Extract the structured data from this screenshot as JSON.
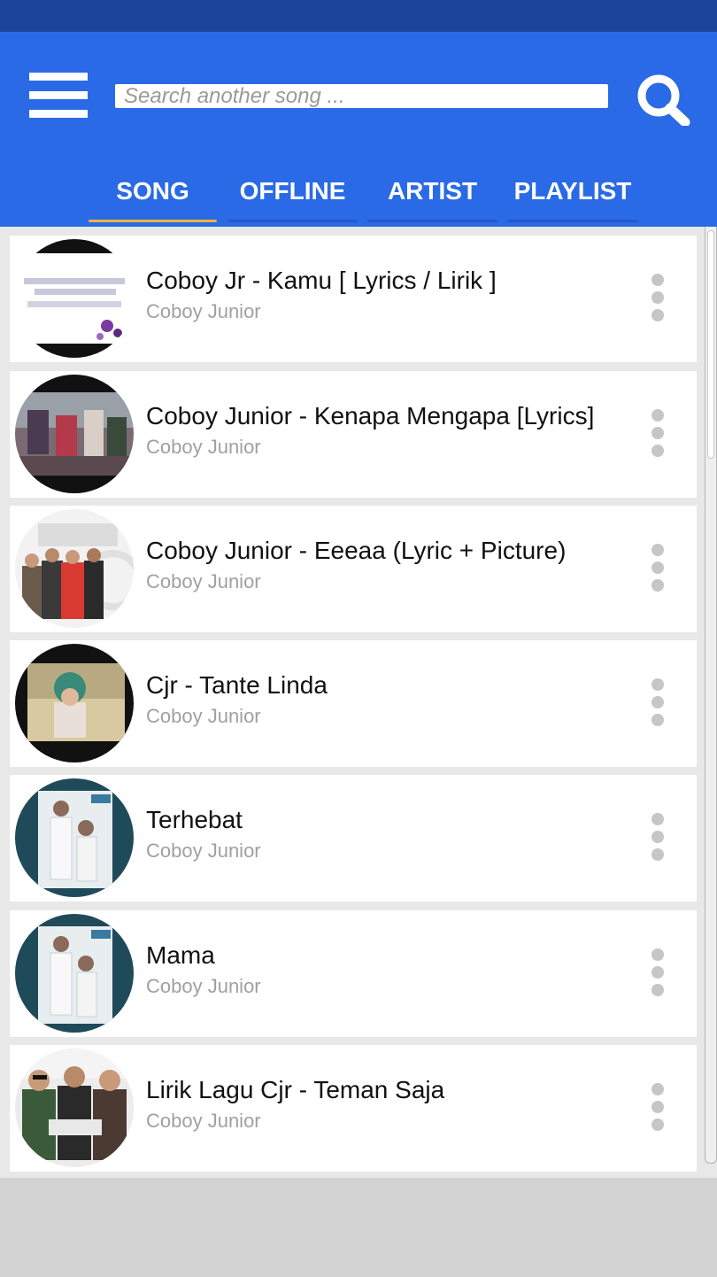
{
  "header": {
    "search_placeholder": "Search another song ...",
    "tabs": [
      {
        "label": "SONG",
        "active": true
      },
      {
        "label": "OFFLINE",
        "active": false
      },
      {
        "label": "ARTIST",
        "active": false
      },
      {
        "label": "PLAYLIST",
        "active": false
      }
    ]
  },
  "songs": [
    {
      "title": "Coboy Jr - Kamu [ Lyrics / Lirik ]",
      "artist": "Coboy Junior"
    },
    {
      "title": "Coboy Junior - Kenapa Mengapa [Lyrics]",
      "artist": "Coboy Junior"
    },
    {
      "title": "Coboy Junior - Eeeaa (Lyric + Picture)",
      "artist": "Coboy Junior"
    },
    {
      "title": "Cjr - Tante Linda",
      "artist": "Coboy Junior"
    },
    {
      "title": "Terhebat",
      "artist": "Coboy Junior"
    },
    {
      "title": "Mama",
      "artist": "Coboy Junior"
    },
    {
      "title": "Lirik Lagu Cjr - Teman Saja",
      "artist": "Coboy Junior"
    }
  ],
  "icons": {
    "menu": "hamburger-menu-icon",
    "search": "search-icon",
    "more": "more-vertical-icon"
  },
  "colors": {
    "status_bar": "#1c4599",
    "header": "#2a6ae6",
    "tab_indicator": "#f0b43c",
    "title_text": "#111111",
    "artist_text": "#a0a0a0"
  }
}
